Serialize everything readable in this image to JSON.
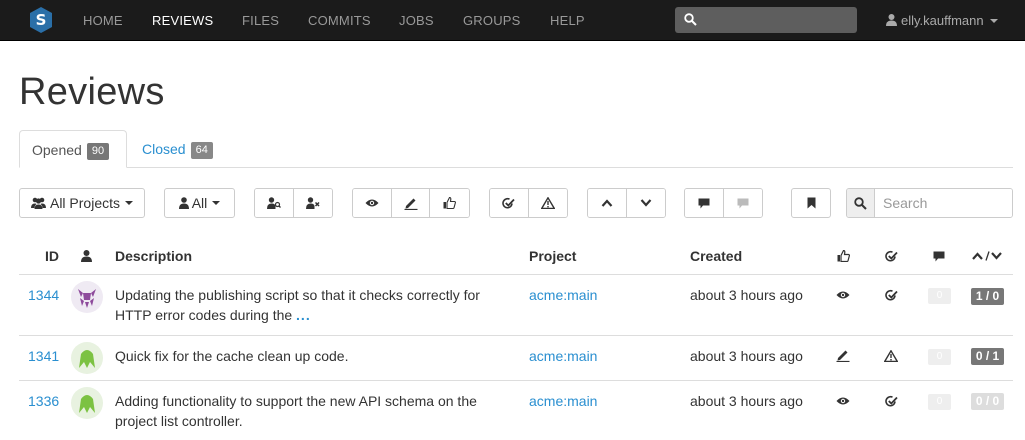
{
  "nav": {
    "items": [
      "HOME",
      "REVIEWS",
      "FILES",
      "COMMITS",
      "JOBS",
      "GROUPS",
      "HELP"
    ],
    "active": "REVIEWS",
    "user": "elly.kauffmann"
  },
  "page": {
    "title": "Reviews"
  },
  "tabs": [
    {
      "label": "Opened",
      "count": "90"
    },
    {
      "label": "Closed",
      "count": "64"
    }
  ],
  "toolbar": {
    "projects_label": "All Projects",
    "users_label": "All",
    "search_placeholder": "Search"
  },
  "table": {
    "headers": {
      "id": "ID",
      "description": "Description",
      "project": "Project",
      "created": "Created"
    },
    "rows": [
      {
        "id": "1344",
        "desc_line1": "Updating the publishing script so that it checks correctly for",
        "desc_line2": "HTTP error codes during the",
        "more": "...",
        "project": "acme:main",
        "created": "about 3 hours ago",
        "status_icon": "eye-icon",
        "test_icon": "check-icon",
        "comments": "0",
        "votes": "1 / 0",
        "avatar": "purple"
      },
      {
        "id": "1341",
        "desc_line1": "Quick fix for the cache clean up code.",
        "desc_line2": "",
        "more": "",
        "project": "acme:main",
        "created": "about 3 hours ago",
        "status_icon": "pencil-icon",
        "test_icon": "warning-icon",
        "comments": "0",
        "votes": "0 / 1",
        "avatar": "green"
      },
      {
        "id": "1336",
        "desc_line1": "Adding functionality to support the new API schema on the",
        "desc_line2": "project list controller.",
        "more": "",
        "project": "acme:main",
        "created": "about 3 hours ago",
        "status_icon": "eye-icon",
        "test_icon": "check-icon",
        "comments": "0",
        "votes": "0 / 0",
        "avatar": "green"
      }
    ]
  }
}
